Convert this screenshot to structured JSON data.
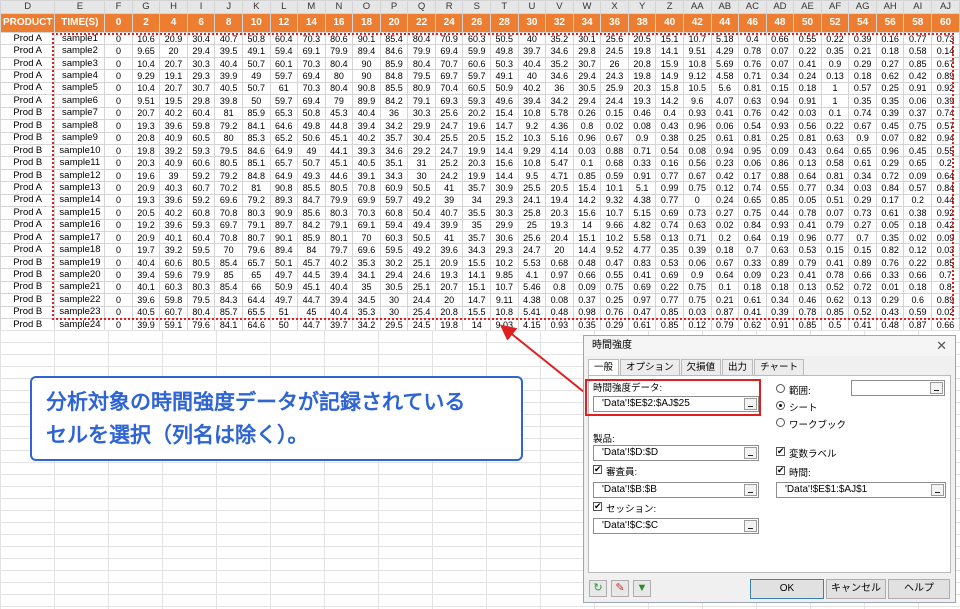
{
  "col_letters": [
    "D",
    "E",
    "F",
    "G",
    "H",
    "I",
    "J",
    "K",
    "L",
    "M",
    "N",
    "O",
    "P",
    "Q",
    "R",
    "S",
    "T",
    "U",
    "V",
    "W",
    "X",
    "Y",
    "Z",
    "AA",
    "AB",
    "AC",
    "AD",
    "AE",
    "AF",
    "AG",
    "AH",
    "AI",
    "AJ"
  ],
  "headers": [
    "PRODUCT",
    "TIME(S)",
    "0",
    "2",
    "4",
    "6",
    "8",
    "10",
    "12",
    "14",
    "16",
    "18",
    "20",
    "22",
    "24",
    "26",
    "28",
    "30",
    "32",
    "34",
    "36",
    "38",
    "40",
    "42",
    "44",
    "46",
    "48",
    "50",
    "52",
    "54",
    "56",
    "58",
    "60"
  ],
  "rows": [
    [
      "Prod A",
      "sample1",
      "0",
      "10.6",
      "20.9",
      "30.4",
      "40.7",
      "50.8",
      "60.4",
      "70.3",
      "80.6",
      "90.1",
      "85.4",
      "80.4",
      "70.9",
      "60.3",
      "50.5",
      "40",
      "35.2",
      "30.1",
      "25.6",
      "20.5",
      "15.1",
      "10.7",
      "5.18",
      "0.4",
      "0.66",
      "0.55",
      "0.22",
      "0.39",
      "0.16",
      "0.77",
      "0.73"
    ],
    [
      "Prod A",
      "sample2",
      "0",
      "9.65",
      "20",
      "29.4",
      "39.5",
      "49.1",
      "59.4",
      "69.1",
      "79.9",
      "89.4",
      "84.6",
      "79.9",
      "69.4",
      "59.9",
      "49.8",
      "39.7",
      "34.6",
      "29.8",
      "24.5",
      "19.8",
      "14.1",
      "9.51",
      "4.29",
      "0.78",
      "0.07",
      "0.22",
      "0.35",
      "0.21",
      "0.18",
      "0.58",
      "0.14"
    ],
    [
      "Prod A",
      "sample3",
      "0",
      "10.4",
      "20.7",
      "30.3",
      "40.4",
      "50.7",
      "60.1",
      "70.3",
      "80.4",
      "90",
      "85.9",
      "80.4",
      "70.7",
      "60.6",
      "50.3",
      "40.4",
      "35.2",
      "30.7",
      "26",
      "20.8",
      "15.9",
      "10.8",
      "5.69",
      "0.76",
      "0.07",
      "0.41",
      "0.9",
      "0.29",
      "0.27",
      "0.85",
      "0.67"
    ],
    [
      "Prod A",
      "sample4",
      "0",
      "9.29",
      "19.1",
      "29.3",
      "39.9",
      "49",
      "59.7",
      "69.4",
      "80",
      "90",
      "84.8",
      "79.5",
      "69.7",
      "59.7",
      "49.1",
      "40",
      "34.6",
      "29.4",
      "24.3",
      "19.8",
      "14.9",
      "9.12",
      "4.58",
      "0.71",
      "0.34",
      "0.24",
      "0.13",
      "0.18",
      "0.62",
      "0.42",
      "0.89"
    ],
    [
      "Prod A",
      "sample5",
      "0",
      "10.4",
      "20.7",
      "30.7",
      "40.5",
      "50.7",
      "61",
      "70.3",
      "80.4",
      "90.8",
      "85.5",
      "80.9",
      "70.4",
      "60.5",
      "50.9",
      "40.2",
      "36",
      "30.5",
      "25.9",
      "20.3",
      "15.8",
      "10.5",
      "5.6",
      "0.81",
      "0.15",
      "0.18",
      "1",
      "0.57",
      "0.25",
      "0.91",
      "0.92"
    ],
    [
      "Prod A",
      "sample6",
      "0",
      "9.51",
      "19.5",
      "29.8",
      "39.8",
      "50",
      "59.7",
      "69.4",
      "79",
      "89.9",
      "84.2",
      "79.1",
      "69.3",
      "59.3",
      "49.6",
      "39.4",
      "34.2",
      "29.4",
      "24.4",
      "19.3",
      "14.2",
      "9.6",
      "4.07",
      "0.63",
      "0.94",
      "0.91",
      "1",
      "0.35",
      "0.35",
      "0.06",
      "0.39"
    ],
    [
      "Prod B",
      "sample7",
      "0",
      "20.7",
      "40.2",
      "60.4",
      "81",
      "85.9",
      "65.3",
      "50.8",
      "45.3",
      "40.4",
      "36",
      "30.3",
      "25.6",
      "20.2",
      "15.4",
      "10.8",
      "5.78",
      "0.26",
      "0.15",
      "0.46",
      "0.4",
      "0.93",
      "0.41",
      "0.76",
      "0.42",
      "0.03",
      "0.1",
      "0.74",
      "0.39",
      "0.37",
      "0.74"
    ],
    [
      "Prod B",
      "sample8",
      "0",
      "19.3",
      "39.6",
      "59.8",
      "79.2",
      "84.1",
      "64.6",
      "49.8",
      "44.8",
      "39.4",
      "34.2",
      "29.9",
      "24.7",
      "19.6",
      "14.7",
      "9.2",
      "4.36",
      "0.8",
      "0.02",
      "0.08",
      "0.43",
      "0.96",
      "0.06",
      "0.54",
      "0.93",
      "0.56",
      "0.22",
      "0.67",
      "0.45",
      "0.75",
      "0.57"
    ],
    [
      "Prod B",
      "sample9",
      "0",
      "20.8",
      "40.9",
      "60.5",
      "80",
      "85.3",
      "65.2",
      "50.6",
      "45.1",
      "40.2",
      "35.7",
      "30.4",
      "25.5",
      "20.5",
      "15.2",
      "10.3",
      "5.16",
      "0.96",
      "0.67",
      "0.9",
      "0.38",
      "0.25",
      "0.61",
      "0.81",
      "0.25",
      "0.81",
      "0.63",
      "0.9",
      "0.07",
      "0.82",
      "0.94"
    ],
    [
      "Prod B",
      "sample10",
      "0",
      "19.8",
      "39.2",
      "59.3",
      "79.5",
      "84.6",
      "64.9",
      "49",
      "44.1",
      "39.3",
      "34.6",
      "29.2",
      "24.7",
      "19.9",
      "14.4",
      "9.29",
      "4.14",
      "0.03",
      "0.88",
      "0.71",
      "0.54",
      "0.08",
      "0.94",
      "0.95",
      "0.09",
      "0.43",
      "0.64",
      "0.65",
      "0.96",
      "0.45",
      "0.55"
    ],
    [
      "Prod B",
      "sample11",
      "0",
      "20.3",
      "40.9",
      "60.6",
      "80.5",
      "85.1",
      "65.7",
      "50.7",
      "45.1",
      "40.5",
      "35.1",
      "31",
      "25.2",
      "20.3",
      "15.6",
      "10.8",
      "5.47",
      "0.1",
      "0.68",
      "0.33",
      "0.16",
      "0.56",
      "0.23",
      "0.06",
      "0.86",
      "0.13",
      "0.58",
      "0.61",
      "0.29",
      "0.65",
      "0.2"
    ],
    [
      "Prod B",
      "sample12",
      "0",
      "19.6",
      "39",
      "59.2",
      "79.2",
      "84.8",
      "64.9",
      "49.3",
      "44.6",
      "39.1",
      "34.3",
      "30",
      "24.2",
      "19.9",
      "14.4",
      "9.5",
      "4.71",
      "0.85",
      "0.59",
      "0.91",
      "0.77",
      "0.67",
      "0.42",
      "0.17",
      "0.88",
      "0.64",
      "0.81",
      "0.34",
      "0.72",
      "0.09",
      "0.64"
    ],
    [
      "Prod A",
      "sample13",
      "0",
      "20.9",
      "40.3",
      "60.7",
      "70.2",
      "81",
      "90.8",
      "85.5",
      "80.5",
      "70.8",
      "60.9",
      "50.5",
      "41",
      "35.7",
      "30.9",
      "25.5",
      "20.5",
      "15.4",
      "10.1",
      "5.1",
      "0.99",
      "0.75",
      "0.12",
      "0.74",
      "0.55",
      "0.77",
      "0.34",
      "0.03",
      "0.84",
      "0.57",
      "0.84"
    ],
    [
      "Prod A",
      "sample14",
      "0",
      "19.3",
      "39.6",
      "59.2",
      "69.6",
      "79.2",
      "89.3",
      "84.7",
      "79.9",
      "69.9",
      "59.7",
      "49.2",
      "39",
      "34",
      "29.3",
      "24.1",
      "19.4",
      "14.2",
      "9.32",
      "4.38",
      "0.77",
      "0",
      "0.24",
      "0.65",
      "0.85",
      "0.05",
      "0.51",
      "0.29",
      "0.17",
      "0.2",
      "0.44"
    ],
    [
      "Prod A",
      "sample15",
      "0",
      "20.5",
      "40.2",
      "60.8",
      "70.8",
      "80.3",
      "90.9",
      "85.6",
      "80.3",
      "70.3",
      "60.8",
      "50.4",
      "40.7",
      "35.5",
      "30.3",
      "25.8",
      "20.3",
      "15.6",
      "10.7",
      "5.15",
      "0.69",
      "0.73",
      "0.27",
      "0.75",
      "0.44",
      "0.78",
      "0.07",
      "0.73",
      "0.61",
      "0.38",
      "0.92"
    ],
    [
      "Prod A",
      "sample16",
      "0",
      "19.2",
      "39.6",
      "59.3",
      "69.7",
      "79.1",
      "89.7",
      "84.2",
      "79.1",
      "69.1",
      "59.4",
      "49.4",
      "39.9",
      "35",
      "29.9",
      "25",
      "19.3",
      "14",
      "9.66",
      "4.82",
      "0.74",
      "0.63",
      "0.02",
      "0.84",
      "0.93",
      "0.41",
      "0.79",
      "0.27",
      "0.05",
      "0.18",
      "0.42"
    ],
    [
      "Prod A",
      "sample17",
      "0",
      "20.9",
      "40.1",
      "60.4",
      "70.8",
      "80.7",
      "90.1",
      "85.9",
      "80.1",
      "70",
      "60.3",
      "50.5",
      "41",
      "35.7",
      "30.6",
      "25.6",
      "20.4",
      "15.1",
      "10.2",
      "5.58",
      "0.13",
      "0.71",
      "0.2",
      "0.64",
      "0.19",
      "0.96",
      "0.77",
      "0.7",
      "0.35",
      "0.02",
      "0.09"
    ],
    [
      "Prod A",
      "sample18",
      "0",
      "19.7",
      "39.2",
      "59.5",
      "70",
      "79.6",
      "89.4",
      "84",
      "79.7",
      "69.6",
      "59.5",
      "49.2",
      "39.6",
      "34.3",
      "29.3",
      "24.7",
      "20",
      "14.4",
      "9.52",
      "4.77",
      "0.35",
      "0.39",
      "0.18",
      "0.7",
      "0.63",
      "0.53",
      "0.15",
      "0.15",
      "0.82",
      "0.12",
      "0.03"
    ],
    [
      "Prod B",
      "sample19",
      "0",
      "40.4",
      "60.6",
      "80.5",
      "85.4",
      "65.7",
      "50.1",
      "45.7",
      "40.2",
      "35.3",
      "30.2",
      "25.1",
      "20.9",
      "15.5",
      "10.2",
      "5.53",
      "0.68",
      "0.48",
      "0.47",
      "0.83",
      "0.53",
      "0.06",
      "0.67",
      "0.33",
      "0.89",
      "0.79",
      "0.41",
      "0.89",
      "0.76",
      "0.22",
      "0.85"
    ],
    [
      "Prod B",
      "sample20",
      "0",
      "39.4",
      "59.6",
      "79.9",
      "85",
      "65",
      "49.7",
      "44.5",
      "39.4",
      "34.1",
      "29.4",
      "24.6",
      "19.3",
      "14.1",
      "9.85",
      "4.1",
      "0.97",
      "0.66",
      "0.55",
      "0.41",
      "0.69",
      "0.9",
      "0.64",
      "0.09",
      "0.23",
      "0.41",
      "0.78",
      "0.66",
      "0.33",
      "0.66",
      "0.7"
    ],
    [
      "Prod B",
      "sample21",
      "0",
      "40.1",
      "60.3",
      "80.3",
      "85.4",
      "66",
      "50.9",
      "45.1",
      "40.4",
      "35",
      "30.5",
      "25.1",
      "20.7",
      "15.1",
      "10.7",
      "5.46",
      "0.8",
      "0.09",
      "0.75",
      "0.69",
      "0.22",
      "0.75",
      "0.1",
      "0.18",
      "0.18",
      "0.13",
      "0.52",
      "0.72",
      "0.01",
      "0.18",
      "0.8"
    ],
    [
      "Prod B",
      "sample22",
      "0",
      "39.6",
      "59.8",
      "79.5",
      "84.3",
      "64.4",
      "49.7",
      "44.7",
      "39.4",
      "34.5",
      "30",
      "24.4",
      "20",
      "14.7",
      "9.11",
      "4.38",
      "0.08",
      "0.37",
      "0.25",
      "0.97",
      "0.77",
      "0.75",
      "0.21",
      "0.61",
      "0.34",
      "0.46",
      "0.62",
      "0.13",
      "0.29",
      "0.6",
      "0.89"
    ],
    [
      "Prod B",
      "sample23",
      "0",
      "40.5",
      "60.7",
      "80.4",
      "85.7",
      "65.5",
      "51",
      "45",
      "40.4",
      "35.3",
      "30",
      "25.4",
      "20.8",
      "15.5",
      "10.8",
      "5.41",
      "0.48",
      "0.98",
      "0.76",
      "0.47",
      "0.85",
      "0.03",
      "0.87",
      "0.41",
      "0.39",
      "0.78",
      "0.85",
      "0.52",
      "0.43",
      "0.59",
      "0.02"
    ],
    [
      "Prod B",
      "sample24",
      "0",
      "39.9",
      "59.1",
      "79.6",
      "84.1",
      "64.6",
      "50",
      "44.7",
      "39.7",
      "34.2",
      "29.5",
      "24.5",
      "19.8",
      "14",
      "9.03",
      "4.15",
      "0.93",
      "0.35",
      "0.29",
      "0.61",
      "0.85",
      "0.12",
      "0.79",
      "0.62",
      "0.91",
      "0.85",
      "0.5",
      "0.41",
      "0.48",
      "0.87",
      "0.66"
    ]
  ],
  "callout": {
    "line1": "分析対象の時間強度データが記録されている",
    "line2": "セルを選択（列名は除く）。"
  },
  "dialog": {
    "title": "時間強度",
    "close": "✕",
    "tabs": [
      "一般",
      "オプション",
      "欠損値",
      "出力",
      "チャート"
    ],
    "time_intensity_label": "時間強度データ:",
    "time_intensity_value": "'Data'!$E$2:$AJ$25",
    "product_label": "製品:",
    "product_value": "'Data'!$D:$D",
    "judge_label": "審査員:",
    "judge_value": "'Data'!$B:$B",
    "session_label": "セッション:",
    "session_value": "'Data'!$C:$C",
    "range_label": "範囲:",
    "sheet_label": "シート",
    "workbook_label": "ワークブック",
    "var_labels_label": "変数ラベル",
    "time_label": "時間:",
    "time_value": "'Data'!$E$1:$AJ$1",
    "ok": "OK",
    "cancel": "キャンセル",
    "help": "ヘルプ",
    "check_mark": "✔"
  },
  "colors": {
    "header_orange": "#ed7d31",
    "callout_blue": "#2e64d3",
    "highlight_red": "#e02020"
  }
}
